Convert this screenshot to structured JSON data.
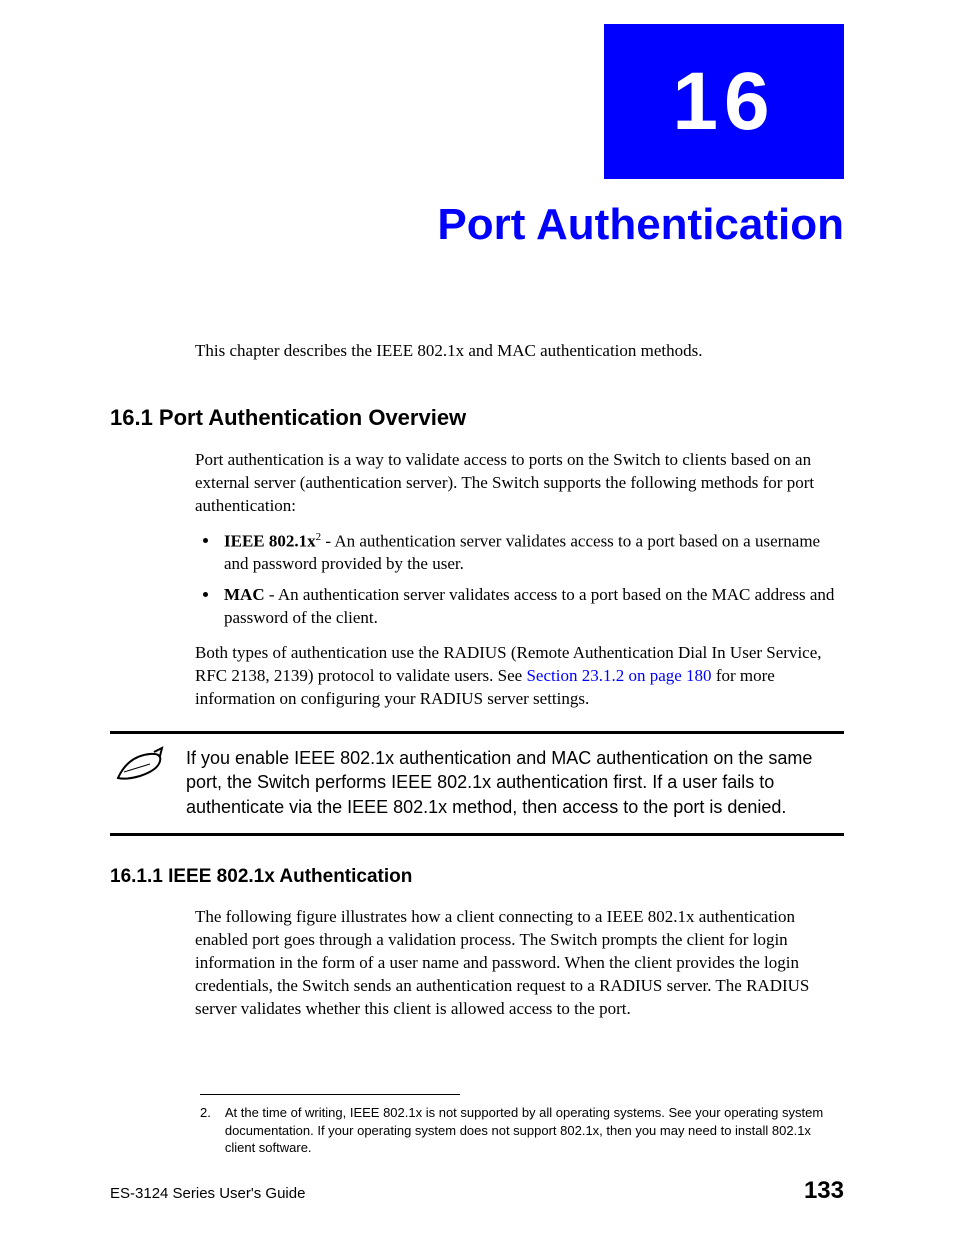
{
  "chapter": {
    "number": "16",
    "title": "Port Authentication"
  },
  "intro": "This chapter describes the IEEE 802.1x and MAC authentication methods.",
  "section1": {
    "heading": "16.1  Port Authentication Overview",
    "p1": "Port authentication is a way to validate access to ports on the Switch to clients based on an external server (authentication server). The Switch supports the following methods for port authentication:",
    "bullet1_bold": "IEEE 802.1x",
    "bullet1_sup": "2",
    "bullet1_rest": " - An authentication server validates access to a port based on a username and password provided by the user.",
    "bullet2_bold": "MAC",
    "bullet2_rest": " - An authentication server validates access to a port based on the MAC address and password of the client.",
    "p2_a": "Both types of authentication use the RADIUS (Remote Authentication Dial In User Service, RFC 2138, 2139) protocol to validate users. See ",
    "p2_link": "Section 23.1.2 on page 180",
    "p2_b": " for more information on configuring your RADIUS server settings."
  },
  "note": "If you enable IEEE 802.1x authentication and MAC authentication on the same port, the Switch performs IEEE 802.1x authentication first. If a user fails to authenticate via the IEEE 802.1x method, then access to the port is denied.",
  "section1_1": {
    "heading": "16.1.1  IEEE 802.1x Authentication",
    "p1": "The following figure illustrates how a client connecting to a IEEE 802.1x authentication enabled port goes through a validation process. The Switch prompts the client for login information in the form of a user name and password. When the client provides the login credentials, the Switch sends an authentication request to a RADIUS server. The RADIUS server validates whether this client is allowed access to the port."
  },
  "footnote": {
    "num": "2.",
    "text": "At the time of writing, IEEE 802.1x is not supported by all operating systems. See your operating system documentation. If your operating system does not support 802.1x, then you may need to install 802.1x client software."
  },
  "footer": {
    "left": "ES-3124 Series User's Guide",
    "right": "133"
  }
}
